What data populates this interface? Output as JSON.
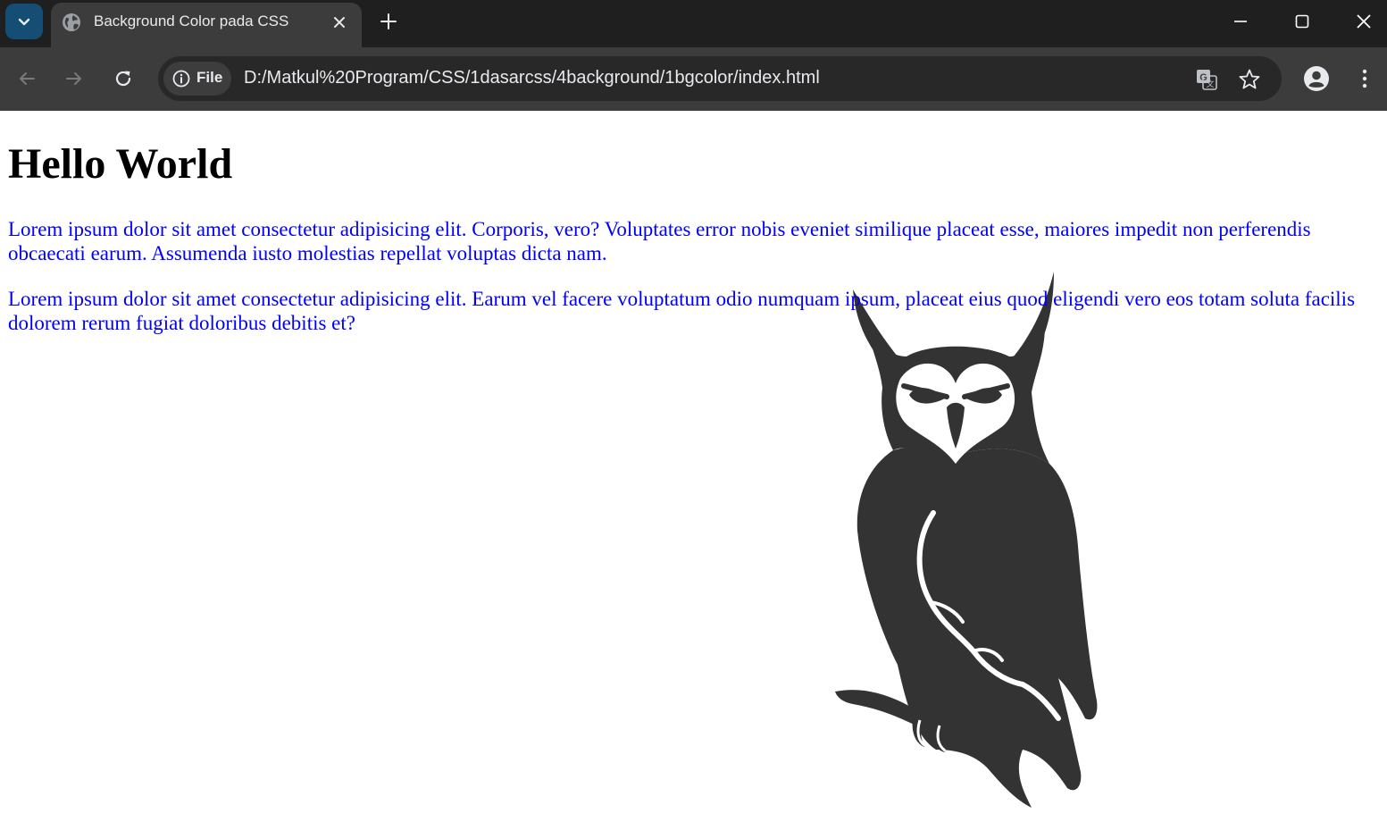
{
  "browser": {
    "tab": {
      "title": "Background Color pada CSS",
      "favicon": "globe-icon"
    },
    "address_bar": {
      "chip_label": "File",
      "url": "D:/Matkul%20Program/CSS/1dasarcss/4background/1bgcolor/index.html"
    },
    "icons": [
      "tab-search-icon",
      "close-icon",
      "plus-icon",
      "minimize-icon",
      "maximize-icon",
      "back-icon",
      "forward-icon",
      "reload-icon",
      "info-icon",
      "translate-icon",
      "star-icon",
      "profile-icon",
      "kebab-menu-icon"
    ]
  },
  "page": {
    "heading": "Hello World",
    "paragraphs": [
      "Lorem ipsum dolor sit amet consectetur adipisicing elit. Corporis, vero? Voluptates error nobis eveniet similique placeat esse, maiores impedit non perferendis obcaecati earum. Assumenda iusto molestias repellat voluptas dicta nam.",
      "Lorem ipsum dolor sit amet consectetur adipisicing elit. Earum vel facere voluptatum odio numquam ipsum, placeat eius quod eligendi vero eos totam soluta facilis dolorem rerum fugiat doloribus debitis et?"
    ],
    "background_image": "owl-silhouette",
    "colors": {
      "heading": "#000000",
      "paragraph": "#0000ff",
      "owl": "#333333",
      "background": "#ffffff"
    }
  }
}
